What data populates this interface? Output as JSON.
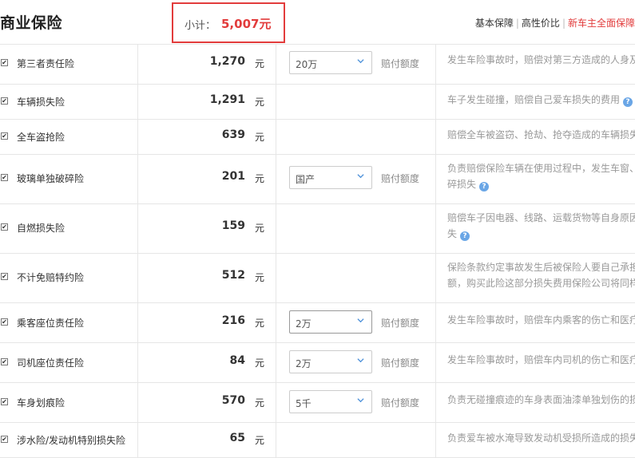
{
  "header": {
    "title": "商业保险",
    "subtotal_label": "小计：",
    "subtotal_value": "5,007元",
    "plans": [
      "基本保障",
      "高性价比",
      "新车主全面保障"
    ]
  },
  "unit": "元",
  "limit_label": "赔付额度",
  "rows": [
    {
      "name": "第三者责任险",
      "price": "1,270",
      "select": "20万",
      "desc_lines": [
        "发生车险事故时，赔偿对第三方造成的人身及"
      ],
      "help": false
    },
    {
      "name": "车辆损失险",
      "price": "1,291",
      "select": null,
      "desc_lines": [
        "车子发生碰撞，赔偿自己爱车损失的费用"
      ],
      "help": true
    },
    {
      "name": "全车盗抢险",
      "price": "639",
      "select": null,
      "desc_lines": [
        "赔偿全车被盗窃、抢劫、抢夺造成的车辆损失"
      ],
      "help": false
    },
    {
      "name": "玻璃单独破碎险",
      "price": "201",
      "select": "国产",
      "desc_lines": [
        "负责赔偿保险车辆在使用过程中，发生车窗、",
        "碎损失"
      ],
      "help": true
    },
    {
      "name": "自燃损失险",
      "price": "159",
      "select": null,
      "desc_lines": [
        "赔偿车子因电器、线路、运载货物等自身原因",
        "失"
      ],
      "help": true
    },
    {
      "name": "不计免赔特约险",
      "price": "512",
      "select": null,
      "desc_lines": [
        "保险条款约定事故发生后被保险人要自己承担",
        "额，购买此险这部分损失费用保险公司将同样"
      ],
      "help": false
    },
    {
      "name": "乘客座位责任险",
      "price": "216",
      "select": "2万",
      "desc_lines": [
        "发生车险事故时，赔偿车内乘客的伤亡和医疗"
      ],
      "help": false
    },
    {
      "name": "司机座位责任险",
      "price": "84",
      "select": "2万",
      "desc_lines": [
        "发生车险事故时，赔偿车内司机的伤亡和医疗"
      ],
      "help": false
    },
    {
      "name": "车身划痕险",
      "price": "570",
      "select": "5千",
      "desc_lines": [
        "负责无碰撞痕迹的车身表面油漆单独划伤的损"
      ],
      "help": false
    },
    {
      "name": "涉水险/发动机特别损失险",
      "price": "65",
      "select": null,
      "desc_lines": [
        "负责爱车被水淹导致发动机受损所造成的损失"
      ],
      "help": false
    }
  ]
}
